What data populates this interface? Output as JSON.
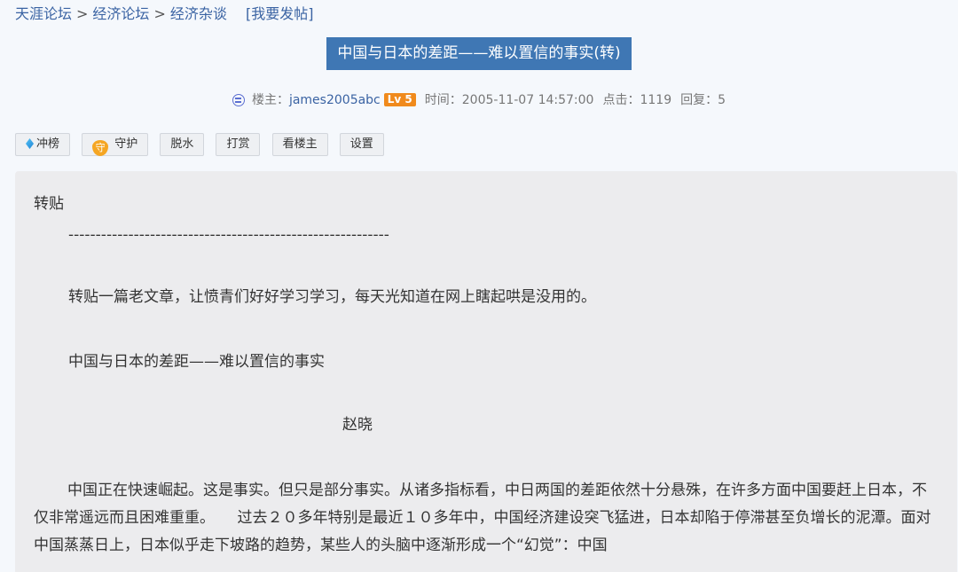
{
  "breadcrumb": {
    "items": [
      "天涯论坛",
      "经济论坛",
      "经济杂谈"
    ],
    "separator": ">",
    "post_link": "[我要发帖]"
  },
  "title": "中国与日本的差距——难以置信的事实(转)",
  "meta": {
    "author_label": "楼主：",
    "author": "james2005abc",
    "level": "Lv 5",
    "time": "时间：2005-11-07 14:57:00",
    "clicks": "点击：1119",
    "replies": "回复：5"
  },
  "toolbar": {
    "boost": "冲榜",
    "guard": "守护",
    "guard_glyph": "守",
    "dry": "脱水",
    "tip": "打赏",
    "op_only": "看楼主",
    "settings": "设置"
  },
  "content": {
    "label": "转贴",
    "divider": "-----------------------------------------------------------",
    "intro": "转贴一篇老文章，让愤青们好好学习学习，每天光知道在网上瞎起哄是没用的。",
    "article_title": "中国与日本的差距——难以置信的事实",
    "author": "赵晓",
    "body": "中国正在快速崛起。这是事实。但只是部分事实。从诸多指标看，中日两国的差距依然十分悬殊，在许多方面中国要赶上日本，不仅非常遥远而且困难重重。　　过去２０多年特别是最近１０多年中，中国经济建设突飞猛进，日本却陷于停滞甚至负增长的泥潭。面对中国蒸蒸日上，日本似乎走下坡路的趋势，某些人的头脑中逐渐形成一个“幻觉”：中国"
  },
  "colors": {
    "link": "#3a63a3",
    "title_bg": "#3f77b4",
    "level_badge": "#f08a1c",
    "content_bg": "#ececee"
  }
}
